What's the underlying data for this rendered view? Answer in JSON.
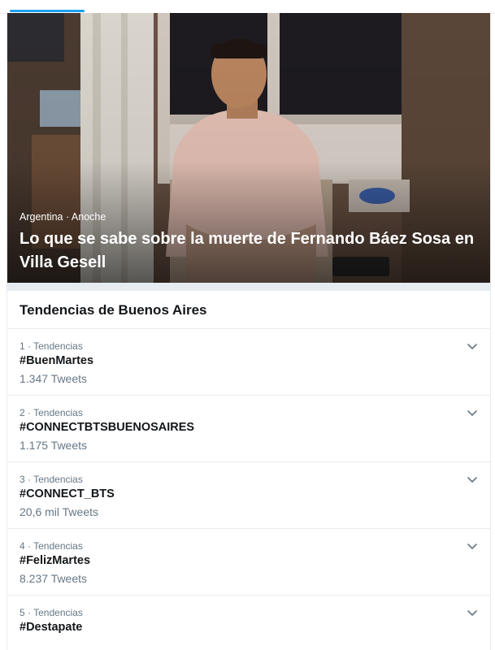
{
  "colors": {
    "accent": "#1da1f2",
    "text_primary": "#14171a",
    "text_secondary": "#657786",
    "divider": "#e6ecf0"
  },
  "hero": {
    "meta": "Argentina · Anoche",
    "title": "Lo que se sabe sobre la muerte de Fernando Báez Sosa en Villa Gesell"
  },
  "trends": {
    "title": "Tendencias de Buenos Aires",
    "items": [
      {
        "meta": "1 · Tendencias",
        "name": "#BuenMartes",
        "count": "1.347 Tweets",
        "icon": "chevron-down-icon"
      },
      {
        "meta": "2 · Tendencias",
        "name": "#CONNECTBTSBUENOSAIRES",
        "count": "1.175 Tweets",
        "icon": "chevron-down-icon"
      },
      {
        "meta": "3 · Tendencias",
        "name": "#CONNECT_BTS",
        "count": "20,6 mil Tweets",
        "icon": "chevron-down-icon"
      },
      {
        "meta": "4 · Tendencias",
        "name": "#FelizMartes",
        "count": "8.237 Tweets",
        "icon": "chevron-down-icon"
      },
      {
        "meta": "5 · Tendencias",
        "name": "#Destapate",
        "count": "",
        "icon": "chevron-down-icon"
      }
    ]
  }
}
